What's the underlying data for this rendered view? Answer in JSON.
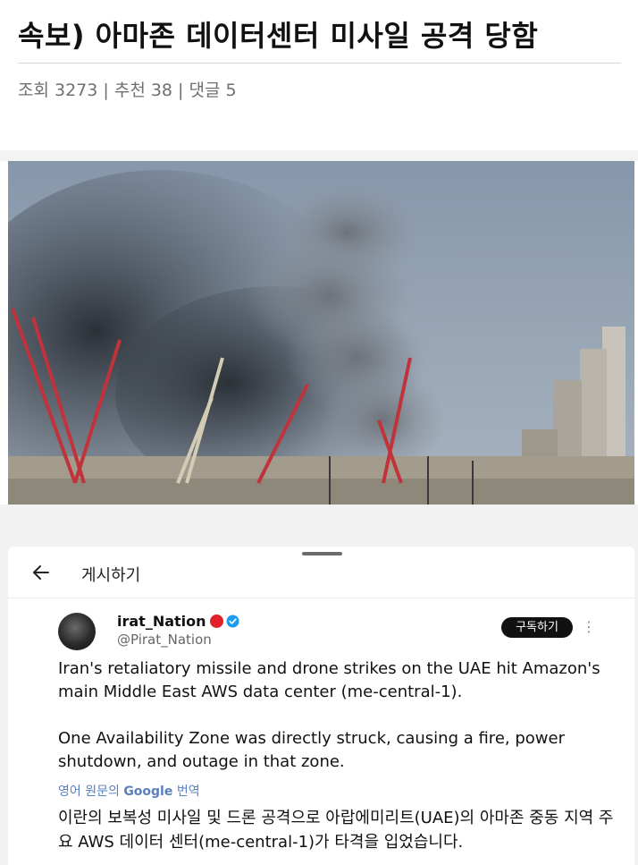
{
  "post": {
    "title": "속보) 아마존 데이터센터 미사일 공격 당함",
    "meta": "조회 3273 | 추천 38 | 댓글 5"
  },
  "photo": {
    "subject": "smoke-plume-over-cranes"
  },
  "sheet": {
    "title": "게시하기",
    "back_icon": "arrow-left-icon"
  },
  "tweet": {
    "display_name": "irat_Nation",
    "handle": "@Pirat_Nation",
    "subscribe_label": "구독하기",
    "more_label": "⋮",
    "paragraph1": "Iran's retaliatory missile and drone strikes on the UAE hit Amazon's main Middle East AWS data center (me-central-1).",
    "paragraph2": "One Availability Zone was directly struck, causing a fire, power shutdown, and outage in that zone.",
    "translate_prefix": "영어 원문의",
    "translate_google": "Google",
    "translate_suffix": "번역",
    "translated_text": "이란의 보복성 미사일 및 드론 공격으로 아랍에미리트(UAE)의 아마존 중동 지역 주요 AWS 데이터 센터(me-central-1)가 타격을 입었습니다."
  },
  "colors": {
    "link_blue": "#5b7fbf",
    "verified_blue": "#1d9bf0",
    "status_red": "#e0202a"
  }
}
